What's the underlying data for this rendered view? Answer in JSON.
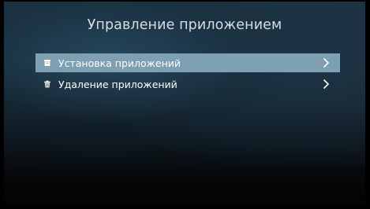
{
  "screen": {
    "title": "Управление приложением"
  },
  "menu": {
    "items": [
      {
        "label": "Установка приложений",
        "icon": "archive-box-icon",
        "selected": true
      },
      {
        "label": "Удаление приложений",
        "icon": "trash-icon",
        "selected": false
      }
    ]
  },
  "colors": {
    "selected_row": "#7f9fb3",
    "text": "#ffffff",
    "title_text": "#d6dde2"
  }
}
